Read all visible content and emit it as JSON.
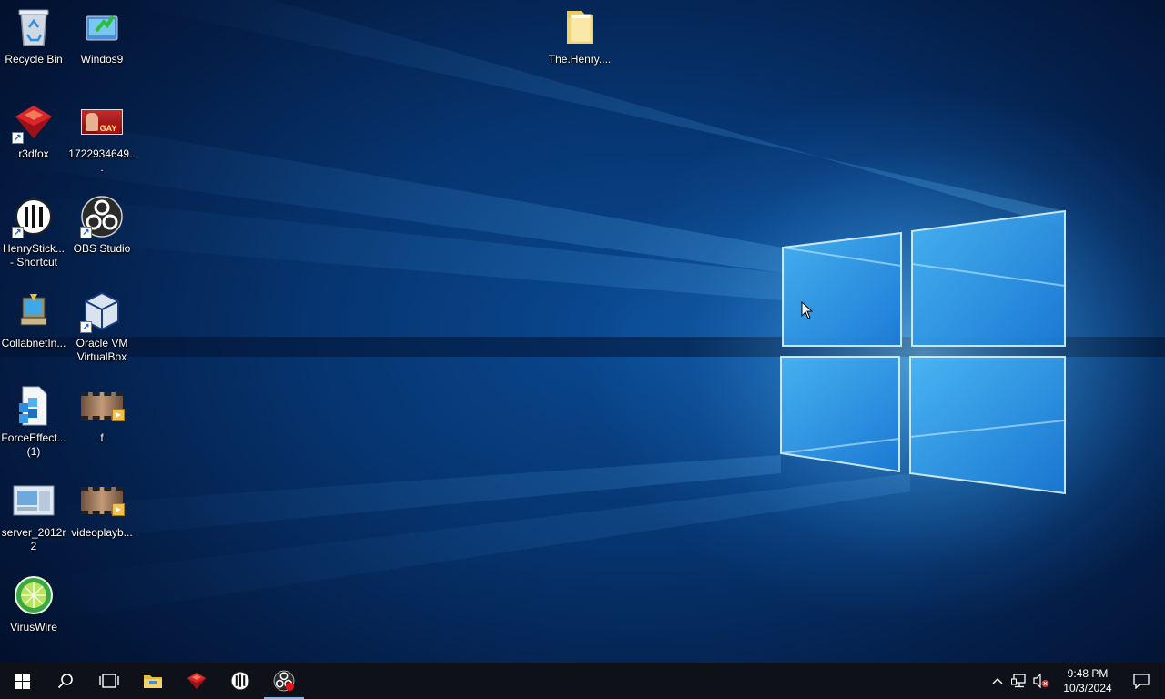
{
  "desktop": {
    "icons": [
      {
        "label": "Recycle Bin",
        "icon": "recycle-bin-icon"
      },
      {
        "label": "Windos9",
        "icon": "windos9-icon"
      },
      {
        "label": "The.Henry....",
        "icon": "folder-icon"
      },
      {
        "label": "r3dfox",
        "icon": "r3dfox-icon"
      },
      {
        "label": "1722934649...",
        "icon": "image-thumbnail-icon",
        "thumb_text": "GAY"
      },
      {
        "label": "HenryStick...\n- Shortcut",
        "icon": "henrystick-icon"
      },
      {
        "label": "OBS Studio",
        "icon": "obs-studio-icon"
      },
      {
        "label": "CollabnetIn...",
        "icon": "installer-icon"
      },
      {
        "label": "Oracle VM\nVirtualBox",
        "icon": "virtualbox-icon"
      },
      {
        "label": "ForceEffect...\n(1)",
        "icon": "forceeffect-file-icon"
      },
      {
        "label": "f",
        "icon": "video-file-icon"
      },
      {
        "label": "server_2012r2",
        "icon": "server-image-icon"
      },
      {
        "label": "videoplayb...",
        "icon": "video-file-icon"
      },
      {
        "label": "VirusWire",
        "icon": "viruswire-icon"
      }
    ]
  },
  "taskbar": {
    "buttons": [
      {
        "name": "start",
        "icon": "windows-logo-icon"
      },
      {
        "name": "search",
        "icon": "search-icon"
      },
      {
        "name": "task-view",
        "icon": "task-view-icon"
      },
      {
        "name": "file-explorer",
        "icon": "file-explorer-icon"
      },
      {
        "name": "r3dfox",
        "icon": "r3dfox-icon"
      },
      {
        "name": "henrystick",
        "icon": "henrystick-icon"
      },
      {
        "name": "obs-studio",
        "icon": "obs-studio-recording-icon",
        "active": true
      }
    ],
    "tray": {
      "chevron_icon": "chevron-up-icon",
      "network_icon": "network-icon",
      "volume_icon": "volume-muted-icon",
      "time": "9:48 PM",
      "date": "10/3/2024",
      "notification_icon": "action-center-icon"
    }
  },
  "colors": {
    "taskbar_bg": "#0e1118",
    "active_indicator": "#7cb6ee",
    "wallpaper_glow": "#2f9be8"
  }
}
